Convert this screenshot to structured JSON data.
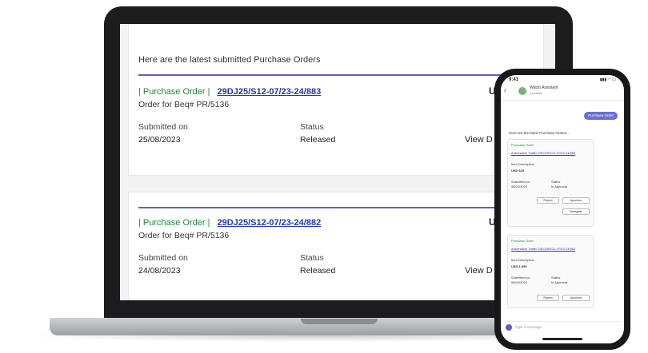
{
  "desktop": {
    "intro": "Here are the latest submitted Purchase Orders",
    "orders": [
      {
        "tag": "| Purchase Order |",
        "number": "29DJ25/S12-07/23-24/883",
        "desc": "Order for Beq# PR/5136",
        "submitted_label": "Submitted on",
        "submitted_value": "25/08/2023",
        "status_label": "Status",
        "status_value": "Released",
        "edge_text": "U",
        "view_text": "View D"
      },
      {
        "tag": "| Purchase Order |",
        "number": "29DJ25/S12-07/23-24/882",
        "desc": "Order for Beq# PR/5136",
        "submitted_label": "Submitted on",
        "submitted_value": "24/08/2023",
        "status_label": "Status",
        "status_value": "Released",
        "edge_text": "U",
        "view_text": "View D"
      }
    ]
  },
  "phone": {
    "time": "9:41",
    "status_icons": "▮▮▮ ◠ ▭",
    "back": "‹",
    "chat_title": "Watch Assistant",
    "chat_subtitle": "Available",
    "pill": "Purchase Order",
    "intro": "Here are the latest Purchase Orders...",
    "cards": [
      {
        "header": "Purchase Order",
        "number": "Automation Traffic 29DJ25/S12-07/23-24/883",
        "desc": "Item Description",
        "amount": "USD 620",
        "submitted_label": "Submitted on",
        "submitted_value": "08/24/2023",
        "status_label": "Status",
        "status_value": "In Approval",
        "btn_reject": "Reject",
        "btn_approve": "Approve",
        "btn_delegate": "Delegate"
      },
      {
        "header": "Purchase Order",
        "number": "Automation Traffic 29DJ25/S12-07/23-24/882",
        "desc": "Item Description",
        "amount": "USD 1,050",
        "submitted_label": "Submitted on",
        "submitted_value": "08/24/2023",
        "status_label": "Status",
        "status_value": "In Approval",
        "btn_reject": "Reject",
        "btn_approve": "Approve"
      }
    ],
    "input_placeholder": "Type a message",
    "accent": "#5b5fc7"
  }
}
